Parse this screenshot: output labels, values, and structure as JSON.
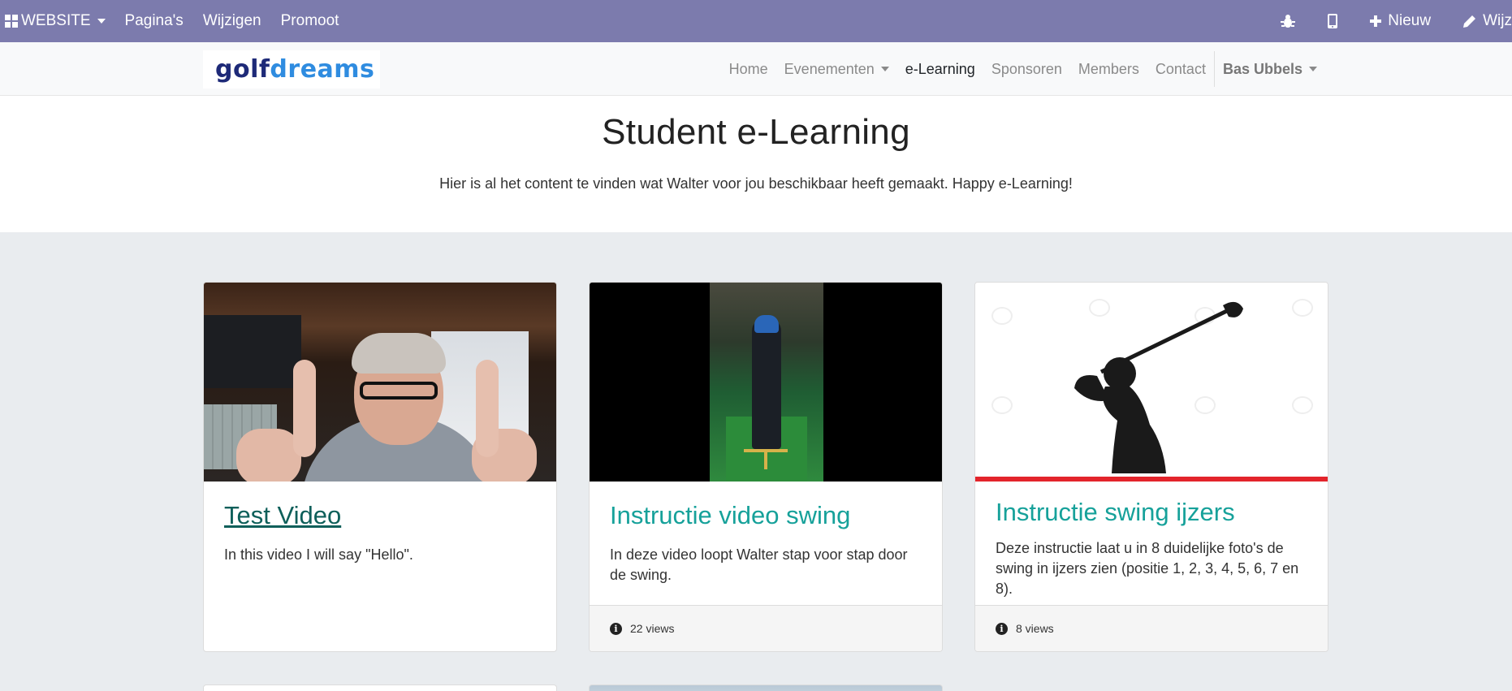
{
  "admin_bar": {
    "website_label": "WEBSITE",
    "pages_label": "Pagina's",
    "edit_label": "Wijzigen",
    "promote_label": "Promoot",
    "new_label": "Nieuw",
    "edit_right_label": "Wijz"
  },
  "site": {
    "logo_part1": "golf",
    "logo_part2": "dreams",
    "nav": {
      "home": "Home",
      "events": "Evenementen",
      "elearning": "e-Learning",
      "sponsors": "Sponsoren",
      "members": "Members",
      "contact": "Contact",
      "user": "Bas Ubbels"
    }
  },
  "hero": {
    "title": "Student e-Learning",
    "subtitle": "Hier is al het content te vinden wat Walter voor jou beschikbaar heeft gemaakt. Happy e-Learning!"
  },
  "cards": [
    {
      "title": "Test Video",
      "description": "In this video I will say \"Hello\"."
    },
    {
      "title": "Instructie video swing",
      "description": "In deze video loopt Walter stap voor stap door de swing.",
      "views": "22 views"
    },
    {
      "title": "Instructie swing ijzers",
      "description": "Deze instructie laat u in 8 duidelijke foto's de swing in ijzers zien (positie 1, 2, 3, 4, 5, 6, 7 en 8).",
      "views": "8 views"
    }
  ],
  "colors": {
    "admin_bar": "#7c7bad",
    "card_title": "#16a19a",
    "page_background": "#e9ecef"
  }
}
